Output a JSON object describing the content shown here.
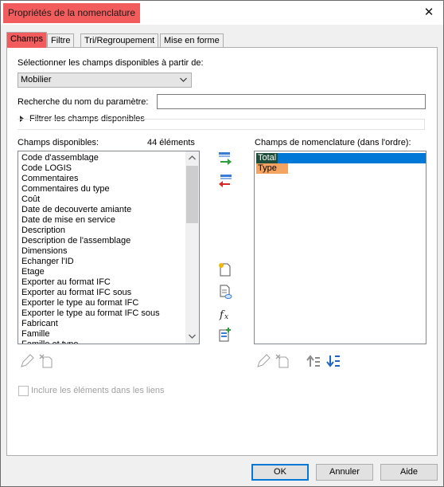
{
  "window": {
    "title": "Propriétés de la nomenclature",
    "close_glyph": "✕"
  },
  "tabs": [
    {
      "label": "Champs",
      "active": true
    },
    {
      "label": "Filtre"
    },
    {
      "label": "Tri/Regroupement"
    },
    {
      "label": "Mise en forme"
    }
  ],
  "fields": {
    "source_label": "Sélectionner les champs disponibles à partir de:",
    "source_value": "Mobilier",
    "search_label": "Recherche du nom du paramètre:",
    "search_value": "",
    "filter_toggle_label": "Filtrer les champs disponibles",
    "available_label": "Champs disponibles:",
    "available_count": "44 éléments",
    "available_items": [
      "Code d'assemblage",
      "Code LOGIS",
      "Commentaires",
      "Commentaires du type",
      "Coût",
      "Date de decouverte amiante",
      "Date de mise en service",
      "Description",
      "Description de l'assemblage",
      "Dimensions",
      "Echanger l'ID",
      "Etage",
      "Exporter au format IFC",
      "Exporter au format IFC sous",
      "Exporter le type au format IFC",
      "Exporter le type au format IFC sous",
      "Fabricant",
      "Famille",
      "Famille et type"
    ],
    "scheduled_label": "Champs de nomenclature (dans l'ordre):",
    "scheduled_items": [
      "Total",
      "Type"
    ],
    "include_links_label": "Inclure les éléments dans les liens"
  },
  "buttons": {
    "ok": "OK",
    "cancel": "Annuler",
    "help": "Aide"
  },
  "colors": {
    "highlight": "#f25c5c",
    "selection": "#0078d7",
    "orange": "#f4a460",
    "dark_green": "#1e4d3b"
  },
  "icons": [
    "add-field-icon",
    "remove-field-icon",
    "new-parameter-icon",
    "edit-parameter-icon",
    "delete-parameter-icon",
    "calculated-value-icon",
    "combine-parameters-icon",
    "add-parameter-icon",
    "move-up-icon",
    "move-down-icon"
  ]
}
